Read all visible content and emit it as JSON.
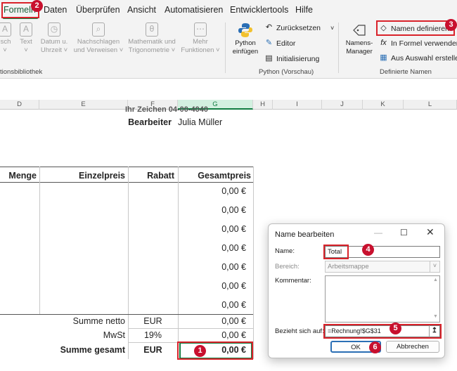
{
  "ribbon": {
    "tabs": [
      "Formeln",
      "Daten",
      "Überprüfen",
      "Ansicht",
      "Automatisieren",
      "Entwicklertools",
      "Hilfe"
    ],
    "function_library": {
      "items": [
        {
          "label1": "isch",
          "label2": "˅",
          "icon": "A"
        },
        {
          "label1": "Text",
          "label2": "˅",
          "icon": "A"
        },
        {
          "label1": "Datum u.",
          "label2": "Uhrzeit ˅",
          "icon": "◷"
        },
        {
          "label1": "Nachschlagen",
          "label2": "und Verweisen ˅",
          "icon": "⌕"
        },
        {
          "label1": "Mathematik und",
          "label2": "Trigonometrie ˅",
          "icon": "θ"
        },
        {
          "label1": "Mehr",
          "label2": "Funktionen ˅",
          "icon": "⋯"
        }
      ],
      "group_label": "tionsbibliothek"
    },
    "python": {
      "button_line1": "Python",
      "button_line2": "einfügen",
      "reset": "Zurücksetzen",
      "editor": "Editor",
      "init": "Initialisierung",
      "group_label": "Python (Vorschau)"
    },
    "names": {
      "manager_line1": "Namens-",
      "manager_line2": "Manager",
      "define": "Namen definieren",
      "use_in_formula": "In Formel verwenden",
      "create_from_selection": "Aus Auswahl erstellen",
      "group_label": "Definierte Namen"
    }
  },
  "grid": {
    "columns": [
      "D",
      "E",
      "F",
      "G",
      "H",
      "I",
      "J",
      "K",
      "L"
    ],
    "partial_top": "Ihr Zeichen   04-00-4040",
    "editor_label": "Bearbeiter",
    "editor_name": "Julia Müller",
    "headers": {
      "menge": "Menge",
      "einzelpreis": "Einzelpreis",
      "rabatt": "Rabatt",
      "gesamtpreis": "Gesamtpreis"
    },
    "amounts": [
      "0,00 €",
      "0,00 €",
      "0,00 €",
      "0,00 €",
      "0,00 €",
      "0,00 €",
      "0,00 €"
    ],
    "summary": [
      {
        "label": "Summe netto",
        "unit": "EUR",
        "value": "0,00 €"
      },
      {
        "label": "MwSt",
        "unit": "19%",
        "value": "0,00 €"
      },
      {
        "label": "Summe gesamt",
        "unit": "EUR",
        "value": "0,00 €"
      }
    ]
  },
  "dialog": {
    "title": "Name bearbeiten",
    "name_label": "Name:",
    "name_value": "Total",
    "scope_label": "Bereich:",
    "scope_value": "Arbeitsmappe",
    "comment_label": "Kommentar:",
    "comment_value": "",
    "refers_label": "Bezieht sich auf:",
    "refers_value": "=Rechnung!$G$31",
    "ok": "OK",
    "cancel": "Abbrechen"
  },
  "badges": [
    "1",
    "2",
    "3",
    "4",
    "5",
    "6"
  ],
  "colors": {
    "excel_green": "#107c41",
    "badge_red": "#c8102e"
  }
}
